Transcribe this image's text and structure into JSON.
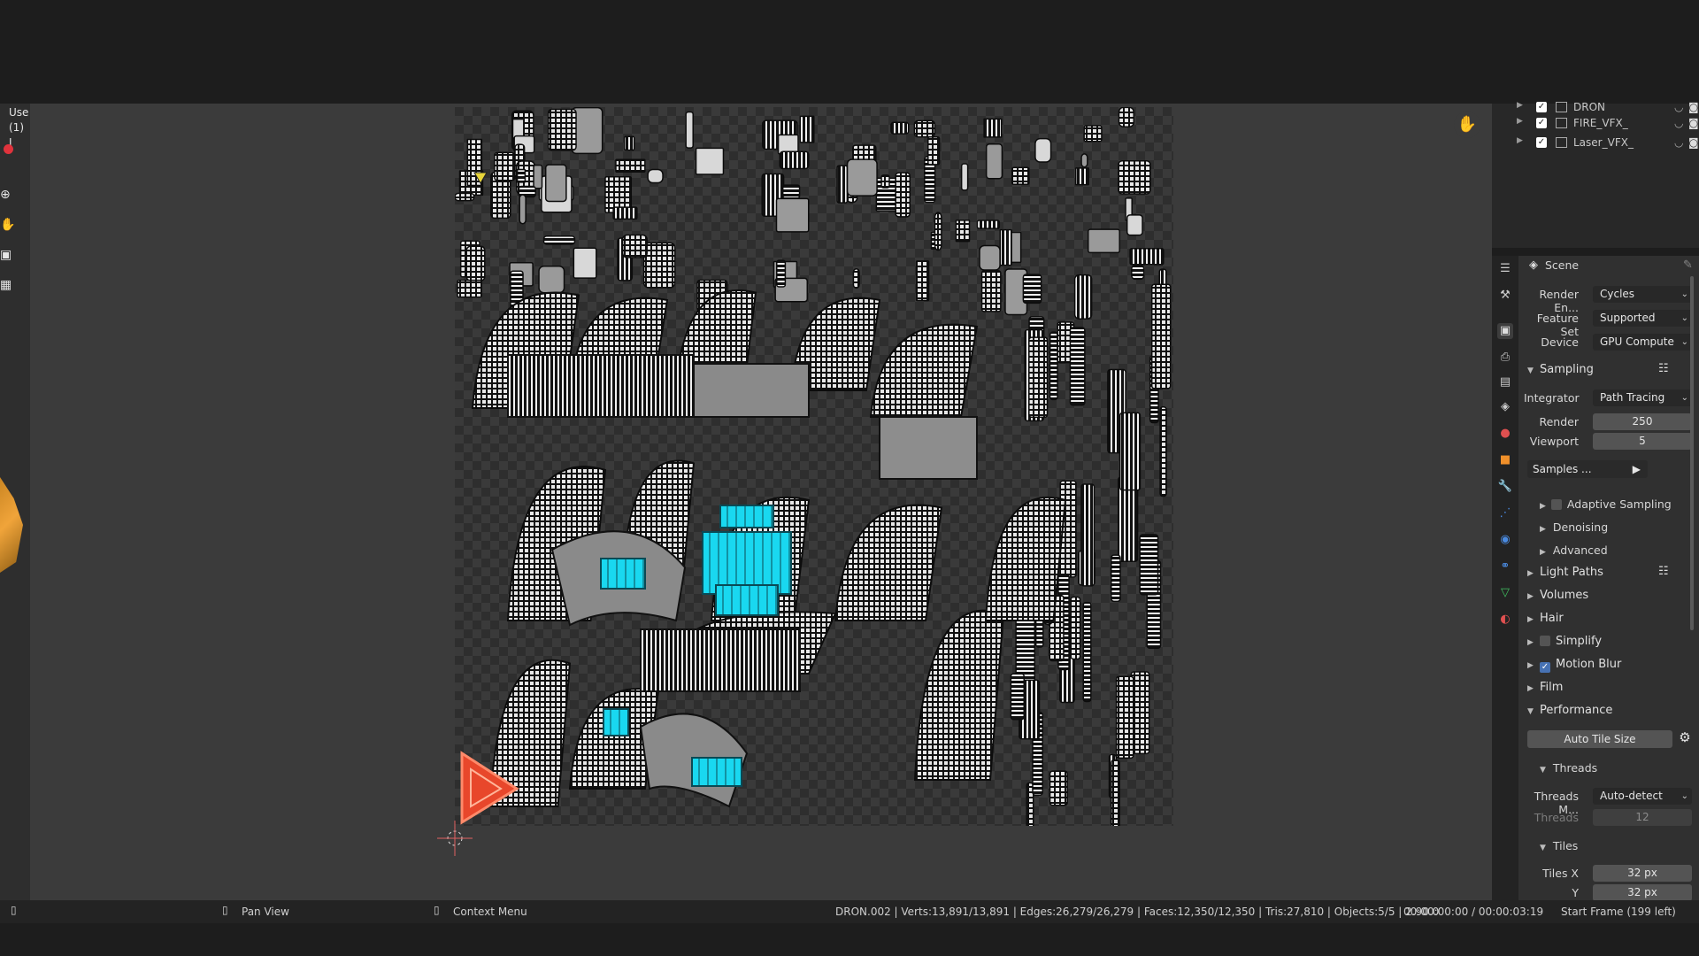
{
  "viewport_overlay": {
    "mode_text": "Use",
    "object_text": "(1) I"
  },
  "outliner": {
    "rows": [
      {
        "name": "DRON",
        "checked": true
      },
      {
        "name": "FIRE_VFX_",
        "checked": true
      },
      {
        "name": "Laser_VFX_",
        "checked": true
      }
    ]
  },
  "properties": {
    "context_name": "Scene",
    "render_engine": {
      "label": "Render En...",
      "value": "Cycles"
    },
    "feature_set": {
      "label": "Feature Set",
      "value": "Supported"
    },
    "device": {
      "label": "Device",
      "value": "GPU Compute"
    },
    "sampling": {
      "title": "Sampling",
      "integrator": {
        "label": "Integrator",
        "value": "Path Tracing"
      },
      "render": {
        "label": "Render",
        "value": "250"
      },
      "viewport": {
        "label": "Viewport",
        "value": "5"
      },
      "samples_menu": "Samples ...",
      "adaptive_sampling": "Adaptive Sampling",
      "denoising": "Denoising",
      "advanced": "Advanced"
    },
    "sections": {
      "light_paths": "Light Paths",
      "volumes": "Volumes",
      "hair": "Hair",
      "simplify": "Simplify",
      "motion_blur": "Motion Blur",
      "film": "Film"
    },
    "motion_blur_enabled": true,
    "simplify_enabled": false,
    "performance": {
      "title": "Performance",
      "auto_tile": "Auto Tile Size",
      "threads_title": "Threads",
      "threads_mode": {
        "label": "Threads M...",
        "value": "Auto-detect"
      },
      "threads": {
        "label": "Threads",
        "value": "12"
      },
      "tiles_title": "Tiles",
      "tiles_x": {
        "label": "Tiles X",
        "value": "32 px"
      },
      "tiles_y": {
        "label": "Y",
        "value": "32 px"
      }
    }
  },
  "statusbar": {
    "pan_view": "Pan View",
    "context_menu": "Context Menu",
    "stats": "DRON.002 | Verts:13,891/13,891 | Edges:26,279/26,279 | Faces:12,350/12,350 | Tris:27,810 | Objects:5/5 | 2.90.0",
    "time": "00:00:00:00 / 00:00:03:19",
    "frame": "Start Frame (199 left)"
  },
  "colors": {
    "accent_blue": "#4772b3",
    "record_red": "#e0333c",
    "uv_cyan": "#19d8f0",
    "uv_orange": "#e8472b"
  },
  "icons": {
    "hand": "hand-icon",
    "zoom": "zoom-icon",
    "camera": "camera-icon",
    "grid": "grid-icon"
  }
}
